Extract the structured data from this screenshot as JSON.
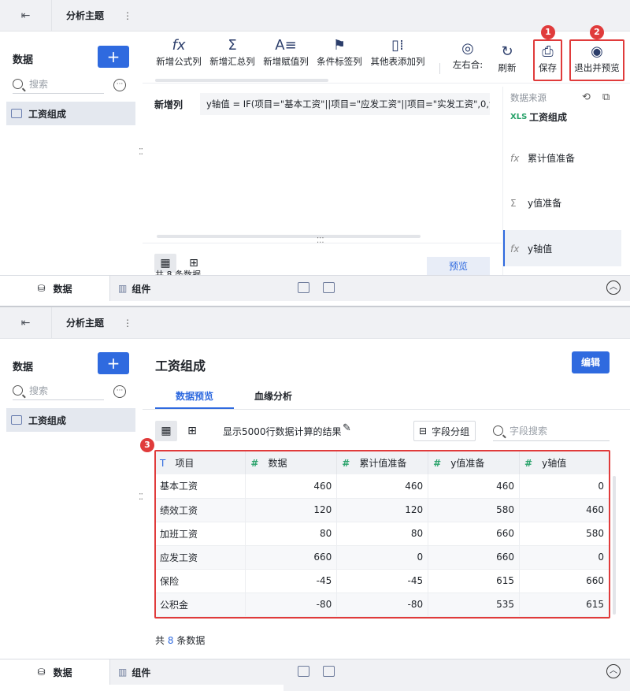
{
  "header": {
    "title": "分析主题",
    "more_label": "⋮"
  },
  "left": {
    "title": "数据",
    "add_label": "+",
    "search_placeholder": "搜索",
    "more_label": "···",
    "item_label": "工资组成"
  },
  "bottom_bar": {
    "data_tab": "数据",
    "component_tab": "组件"
  },
  "toolbar": {
    "items": [
      {
        "label": "新增公式列",
        "glyph": "fx"
      },
      {
        "label": "新增汇总列",
        "glyph": "Σ"
      },
      {
        "label": "新增赋值列",
        "glyph": "A≡"
      },
      {
        "label": "条件标签列",
        "glyph": "⚑"
      },
      {
        "label": "其他表添加列",
        "glyph": "▯⁞"
      },
      {
        "label": "左右合:",
        "glyph": "◎"
      },
      {
        "label": "刷新",
        "glyph": "↻"
      },
      {
        "label": "保存",
        "glyph": "⎙"
      },
      {
        "label": "退出并预览",
        "glyph": "◉"
      }
    ],
    "badges": [
      "1",
      "2",
      "3"
    ]
  },
  "editor": {
    "new_col_label": "新增列",
    "formula": "y轴值 = IF(项目=\"基本工资\"||项目=\"应发工资\"||项目=\"实发工资\",0,y值",
    "count_text": "共 8 条数据",
    "preview_label": "预览"
  },
  "source_panel": {
    "title": "数据来源",
    "items": [
      {
        "icon": "XLS",
        "label": "工资组成"
      },
      {
        "icon": "fx",
        "label": "累计值准备"
      },
      {
        "icon": "Σ",
        "label": "y值准备"
      },
      {
        "icon": "fx",
        "label": "y轴值"
      }
    ]
  },
  "detail": {
    "title": "工资组成",
    "edit_label": "编辑",
    "tabs": [
      "数据预览",
      "血缘分析"
    ],
    "info_text": "显示5000行数据计算的结果",
    "group_label": "字段分组",
    "field_search_placeholder": "字段搜索",
    "columns": [
      "项目",
      "数据",
      "累计值准备",
      "y值准备",
      "y轴值"
    ],
    "rows": [
      [
        "基本工资",
        "460",
        "460",
        "460",
        "0"
      ],
      [
        "绩效工资",
        "120",
        "120",
        "580",
        "460"
      ],
      [
        "加班工资",
        "80",
        "80",
        "660",
        "580"
      ],
      [
        "应发工资",
        "660",
        "0",
        "660",
        "0"
      ],
      [
        "保险",
        "-45",
        "-45",
        "615",
        "660"
      ],
      [
        "公积金",
        "-80",
        "-80",
        "535",
        "615"
      ]
    ],
    "footer_prefix": "共",
    "footer_count": "8",
    "footer_suffix": "条数据"
  },
  "colors": {
    "accent": "#2f6adf",
    "highlight": "#e03b3b",
    "green": "#2aa36b"
  }
}
